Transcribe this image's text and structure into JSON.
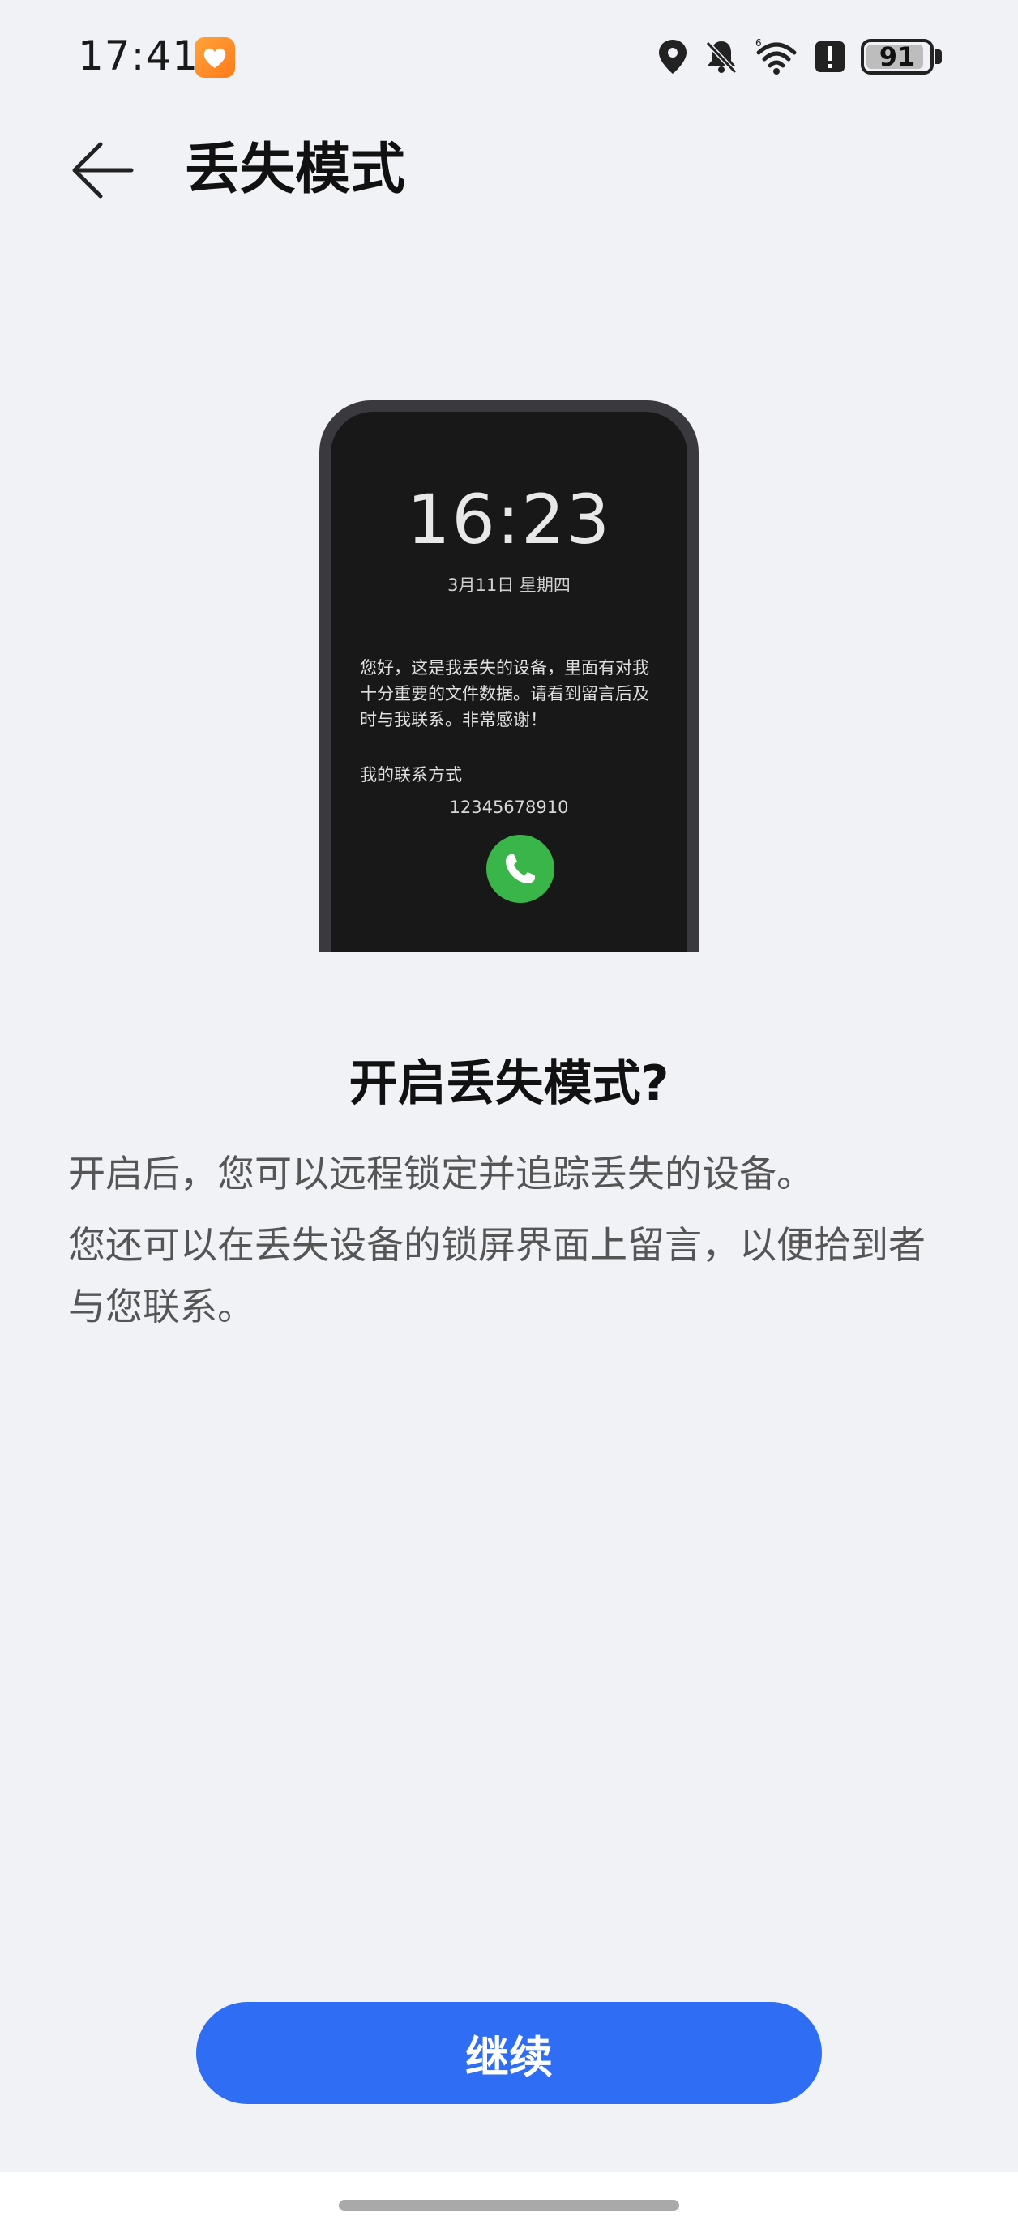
{
  "status_bar": {
    "time": "17:41",
    "battery": "91",
    "icons": [
      "health-app-icon",
      "location-icon",
      "mute-icon",
      "wifi-icon",
      "alert-icon",
      "battery-icon"
    ]
  },
  "header": {
    "back_icon": "arrow-left-icon",
    "title": "丢失模式"
  },
  "illustration": {
    "lock_time": "16:23",
    "lock_date": "3月11日 星期四",
    "message": "您好，这是我丢失的设备，里面有对我十分重要的文件数据。请看到留言后及时与我联系。非常感谢！",
    "contact_label": "我的联系方式",
    "contact_number": "12345678910",
    "call_icon": "phone-icon"
  },
  "content": {
    "title": "开启丢失模式?",
    "desc_1": "开启后，您可以远程锁定并追踪丢失的设备。",
    "desc_2": "您还可以在丢失设备的锁屏界面上留言，以便拾到者与您联系。"
  },
  "actions": {
    "continue_label": "继续"
  },
  "colors": {
    "background": "#f1f2f6",
    "accent": "#2f6ef4",
    "call_green": "#3ab54a"
  }
}
